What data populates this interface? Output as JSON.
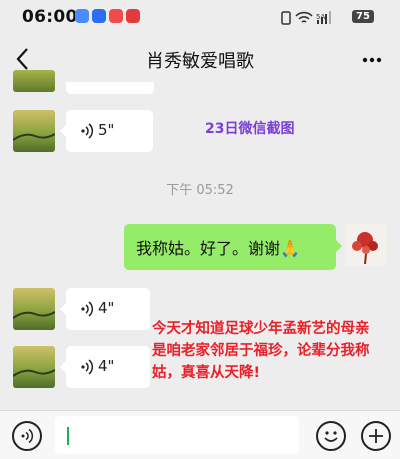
{
  "status": {
    "time": "06:00",
    "battery": "75",
    "net": "5A"
  },
  "header": {
    "title": "肖秀敏爱唱歌"
  },
  "messages": {
    "voice1": {
      "duration": "5\""
    },
    "voice2": {
      "duration": "4\""
    },
    "voice3": {
      "duration": "4\""
    },
    "timestamp": "下午 05:52",
    "sent_text": "我称姑。好了。谢谢",
    "sent_emoji": "🙏"
  },
  "overlay": {
    "label": "23日微信截图"
  },
  "caption": {
    "text": "今天才知道足球少年孟新艺的母亲是咱老家邻居于福珍，论辈分我称姑，真喜从天降!"
  },
  "colors": {
    "accent_green": "#95ec69",
    "caption_red": "#e8212a",
    "overlay_purple": "#7b3fd6"
  },
  "icons": [
    "back-icon",
    "more-icon",
    "voice-wave-icon",
    "voice-mode-icon",
    "emoji-icon",
    "add-icon"
  ]
}
